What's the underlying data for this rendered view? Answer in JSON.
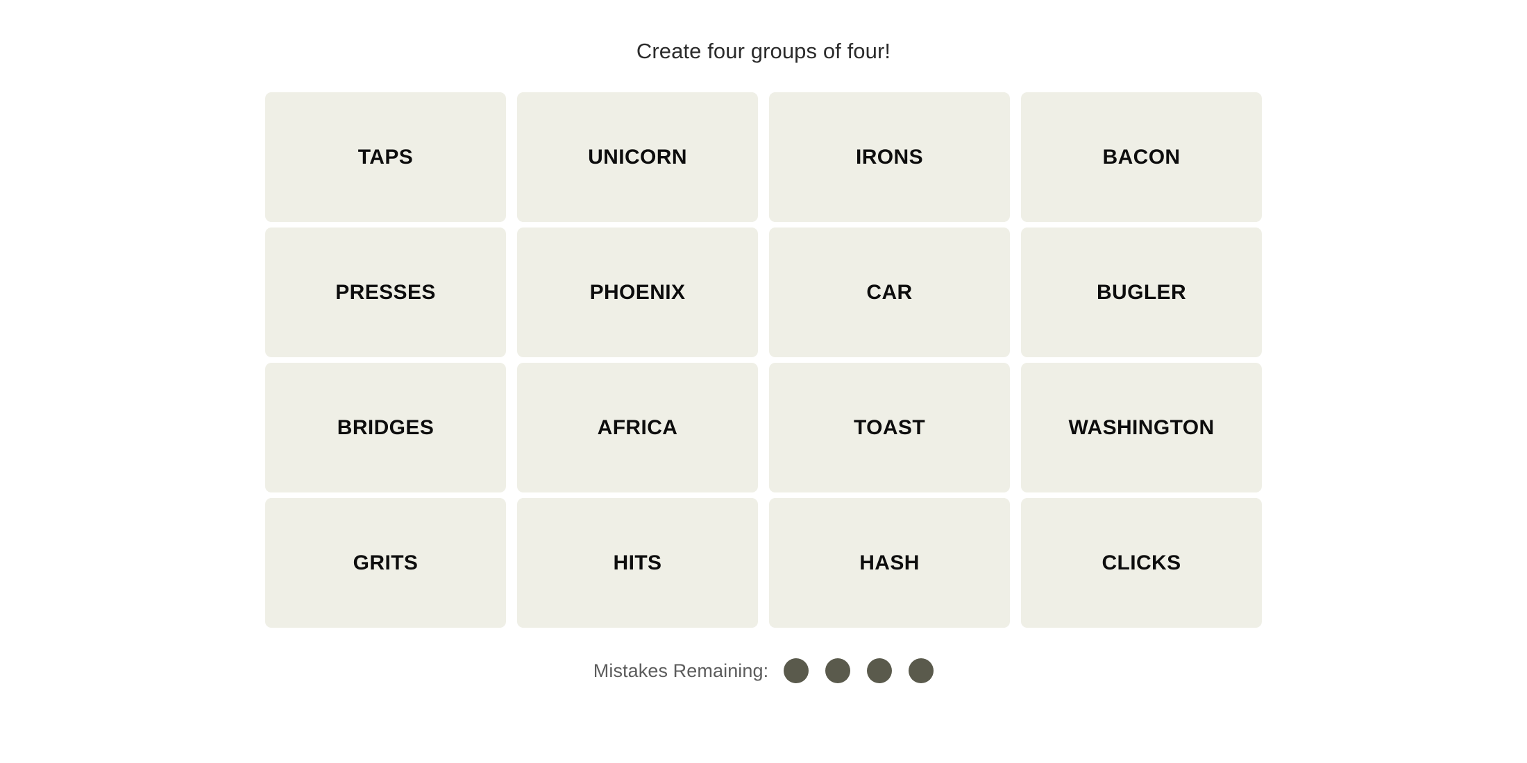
{
  "page": {
    "background_color": "#ffffff"
  },
  "header": {
    "title": "Create four groups of four!"
  },
  "board": {
    "rows": 4,
    "columns": 4,
    "tile_color": "#efefe6",
    "tile_text_color": "#0d0d0d",
    "tiles": [
      {
        "label": "TAPS"
      },
      {
        "label": "UNICORN"
      },
      {
        "label": "IRONS"
      },
      {
        "label": "BACON"
      },
      {
        "label": "PRESSES"
      },
      {
        "label": "PHOENIX"
      },
      {
        "label": "CAR"
      },
      {
        "label": "BUGLER"
      },
      {
        "label": "BRIDGES"
      },
      {
        "label": "AFRICA"
      },
      {
        "label": "TOAST"
      },
      {
        "label": "WASHINGTON"
      },
      {
        "label": "GRITS"
      },
      {
        "label": "HITS"
      },
      {
        "label": "HASH"
      },
      {
        "label": "CLICKS"
      }
    ]
  },
  "footer": {
    "mistakes_label": "Mistakes Remaining:",
    "mistakes_remaining": 4,
    "dot_color": "#5a5a4c",
    "label_color": "#5c5c5c",
    "dots": [
      {
        "name": "mistake-dot-1"
      },
      {
        "name": "mistake-dot-2"
      },
      {
        "name": "mistake-dot-3"
      },
      {
        "name": "mistake-dot-4"
      }
    ]
  }
}
